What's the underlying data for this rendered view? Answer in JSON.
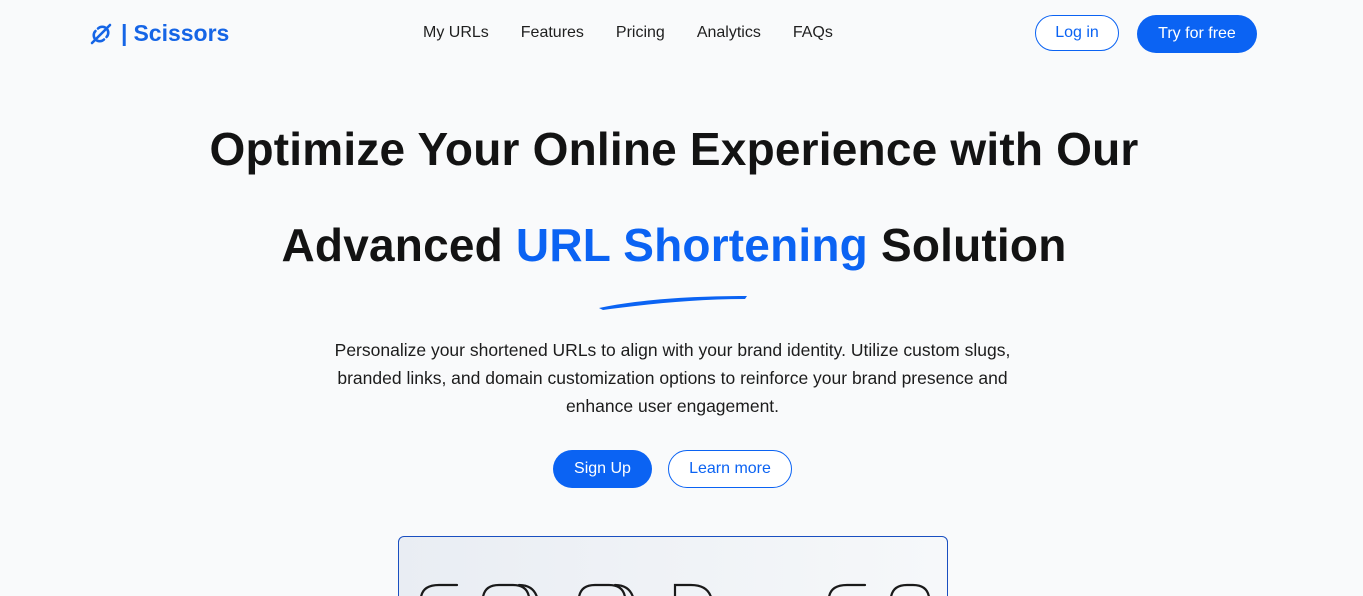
{
  "brand": {
    "name": "Scissors",
    "separator": "|",
    "logo_icon": "link-broken-icon",
    "accent_color": "#0b63f3"
  },
  "nav": {
    "links": [
      "My URLs",
      "Features",
      "Pricing",
      "Analytics",
      "FAQs"
    ],
    "login_label": "Log in",
    "try_label": "Try for free"
  },
  "hero": {
    "line1": "Optimize Your Online Experience with Our",
    "line2_before": "Advanced ",
    "line2_accent": "URL Shortening",
    "line2_after": " Solution",
    "subtitle": "Personalize your shortened URLs to align with your brand identity. Utilize custom slugs, branded links, and domain customization options to reinforce your brand presence and enhance user engagement.",
    "signup_label": "Sign Up",
    "learn_label": "Learn more"
  }
}
